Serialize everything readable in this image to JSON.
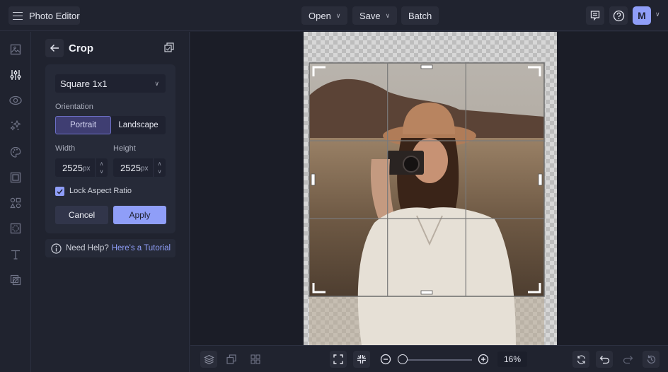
{
  "app": {
    "title": "Photo Editor",
    "menu_icon": "hamburger-icon"
  },
  "topbar": {
    "menus": [
      {
        "label": "Open",
        "has_dropdown": true
      },
      {
        "label": "Save",
        "has_dropdown": true
      },
      {
        "label": "Batch",
        "has_dropdown": false
      }
    ],
    "right_icons": [
      "comment-icon",
      "help-icon"
    ],
    "avatar_initial": "M",
    "accent": "#8f9ef8"
  },
  "rail": {
    "items": [
      {
        "icon": "image-icon",
        "active": false
      },
      {
        "icon": "adjust-sliders-icon",
        "active": true
      },
      {
        "icon": "eye-icon",
        "active": false
      },
      {
        "icon": "sparkles-icon",
        "active": false
      },
      {
        "icon": "palette-icon",
        "active": false
      },
      {
        "icon": "frame-icon",
        "active": false
      },
      {
        "icon": "shapes-icon",
        "active": false
      },
      {
        "icon": "texture-icon",
        "active": false
      },
      {
        "icon": "text-icon",
        "active": false
      },
      {
        "icon": "overlay-icon",
        "active": false
      }
    ]
  },
  "panel": {
    "title": "Crop",
    "preset": "Square 1x1",
    "orientation_label": "Orientation",
    "orientation_options": [
      "Portrait",
      "Landscape"
    ],
    "orientation_selected": "Portrait",
    "width_label": "Width",
    "height_label": "Height",
    "width_value": "2525",
    "height_value": "2525",
    "unit": "px",
    "lock_label": "Lock Aspect Ratio",
    "lock_checked": true,
    "cancel_label": "Cancel",
    "apply_label": "Apply",
    "help_text": "Need Help?",
    "help_link": "Here's a Tutorial"
  },
  "canvas": {
    "crop_grid": "3x3",
    "aspect": "1:1"
  },
  "bottombar": {
    "left_icons": [
      "layers-icon",
      "duplicate-icon",
      "grid-icon"
    ],
    "fit_icons": [
      "fit-screen-icon",
      "shrink-icon"
    ],
    "zoom_value": "16%",
    "zoom_percent": 16,
    "right_icons": [
      "reset-icon",
      "undo-icon",
      "redo-icon",
      "history-icon"
    ]
  }
}
